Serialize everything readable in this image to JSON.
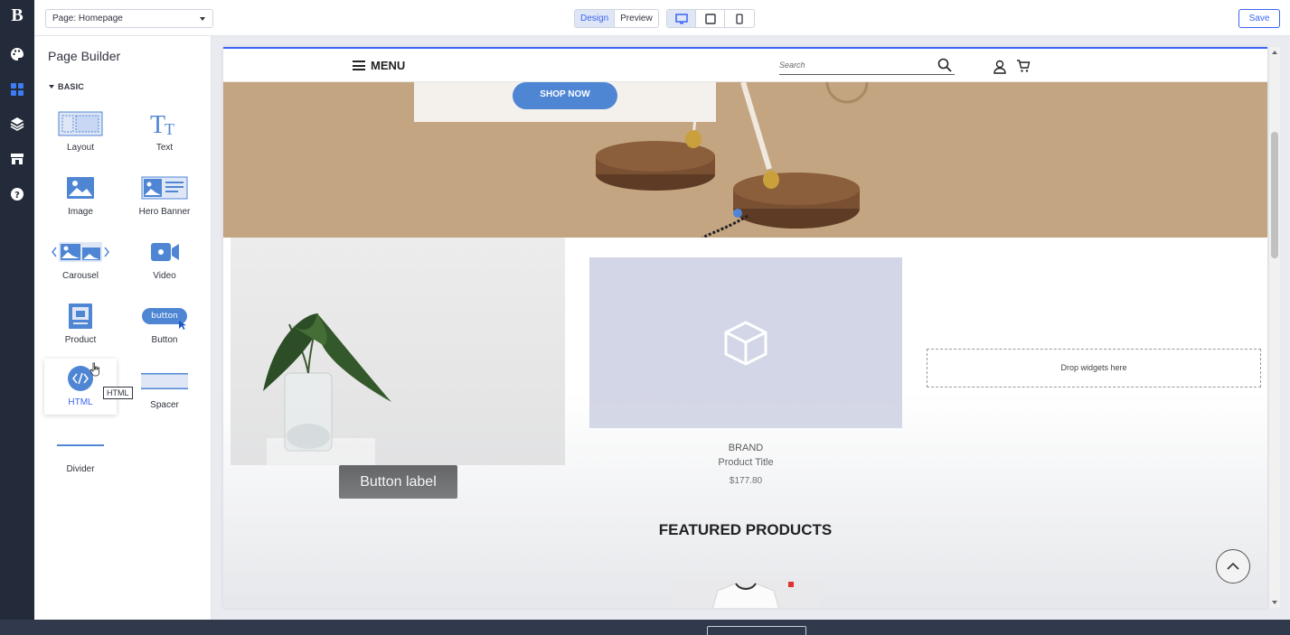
{
  "topbar": {
    "page_select": "Page: Homepage",
    "design_label": "Design",
    "preview_label": "Preview",
    "save_label": "Save"
  },
  "sidebar": {
    "title": "Page Builder",
    "section": "BASIC",
    "widgets": [
      {
        "label": "Layout",
        "icon": "layout-icon"
      },
      {
        "label": "Text",
        "icon": "text-icon"
      },
      {
        "label": "Image",
        "icon": "image-icon"
      },
      {
        "label": "Hero Banner",
        "icon": "hero-banner-icon"
      },
      {
        "label": "Carousel",
        "icon": "carousel-icon"
      },
      {
        "label": "Video",
        "icon": "video-icon"
      },
      {
        "label": "Product",
        "icon": "product-icon"
      },
      {
        "label": "Button",
        "icon": "button-icon",
        "icon_text": "button"
      },
      {
        "label": "HTML",
        "icon": "html-icon"
      },
      {
        "label": "Spacer",
        "icon": "spacer-icon"
      },
      {
        "label": "Divider",
        "icon": "divider-icon"
      }
    ],
    "tooltip": "HTML"
  },
  "store": {
    "menu_label": "MENU",
    "search_placeholder": "Search",
    "shop_now": "SHOP NOW",
    "button_label": "Button label",
    "product": {
      "brand": "BRAND",
      "title": "Product Title",
      "price": "$177.80"
    },
    "drop_zone": "Drop widgets here",
    "featured_heading": "FEATURED PRODUCTS"
  },
  "colors": {
    "accent": "#3c64f4",
    "rail": "#232a3a",
    "widget_blue": "#4f86d4",
    "hero_bg": "#c4a581"
  }
}
